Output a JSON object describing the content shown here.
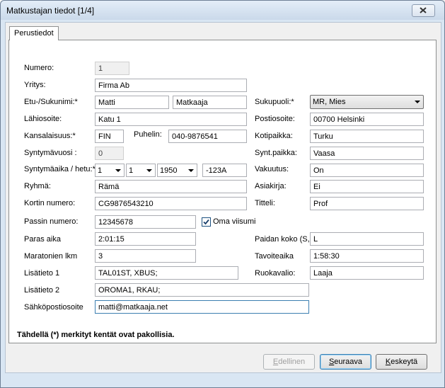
{
  "window": {
    "title": "Matkustajan tiedot [1/4]"
  },
  "tabs": {
    "basic": "Perustiedot"
  },
  "left": {
    "numero": {
      "label": "Numero:",
      "value": "1"
    },
    "yritys": {
      "label": "Yritys:",
      "value": "Firma Ab"
    },
    "nimi": {
      "label": "Etu-/Sukunimi:*",
      "first": "Matti",
      "last": "Matkaaja"
    },
    "lahiosoite": {
      "label": "Lähiosoite:",
      "value": "Katu 1"
    },
    "kansalaisuus": {
      "label": "Kansalaisuus:*",
      "value": "FIN"
    },
    "puhelin": {
      "label": "Puhelin:",
      "value": "040-9876541"
    },
    "syntymavuosi": {
      "label": "Syntymävuosi :",
      "value": "0"
    },
    "syntymaaika": {
      "label": "Syntymäaika / hetu:*",
      "day": "1",
      "month": "1",
      "year": "1950",
      "hetu": "-123A"
    },
    "ryhma": {
      "label": "Ryhmä:",
      "value": "Rämä"
    },
    "kortin_numero": {
      "label": "Kortin numero:",
      "value": "CG9876543210"
    },
    "passin_numero": {
      "label": "Passin numero:",
      "value": "12345678"
    },
    "oma_viisumi": {
      "label": "Oma viisumi",
      "checked": true
    },
    "paras_aika": {
      "label": "Paras aika",
      "value": "2:01:15"
    },
    "maratonien_lkm": {
      "label": "Maratonien lkm",
      "value": "3"
    },
    "lisatieto1": {
      "label": "Lisätieto 1",
      "value": "TAL01ST, XBUS;"
    },
    "lisatieto2": {
      "label": "Lisätieto 2",
      "value": "OROMA1, RKAU;"
    },
    "sahkoposti": {
      "label": "Sähköpostiosoite",
      "value": "matti@matkaaja.net"
    }
  },
  "right": {
    "sukupuoli": {
      "label": "Sukupuoli:*",
      "value": "MR, Mies"
    },
    "postiosoite": {
      "label": "Postiosoite:",
      "value": "00700 Helsinki"
    },
    "kotipaikka": {
      "label": "Kotipaikka:",
      "value": "Turku"
    },
    "syntpaikka": {
      "label": "Synt.paikka:",
      "value": "Vaasa"
    },
    "vakuutus": {
      "label": "Vakuutus:",
      "value": "On"
    },
    "asiakirja": {
      "label": "Asiakirja:",
      "value": "Ei"
    },
    "titteli": {
      "label": "Titteli:",
      "value": "Prof"
    },
    "paidan_koko": {
      "label": "Paidan koko (S,M",
      "value": "L"
    },
    "tavoiteaika": {
      "label": "Tavoiteaika",
      "value": "1:58:30"
    },
    "ruokavalio": {
      "label": "Ruokavalio:",
      "value": "Laaja"
    }
  },
  "note": "Tähdellä (*) merkityt kentät ovat pakollisia.",
  "buttons": {
    "prev": {
      "first": "E",
      "rest": "dellinen"
    },
    "next": {
      "first": "S",
      "rest": "euraava"
    },
    "cancel": {
      "first": "K",
      "rest": "eskeytä"
    }
  }
}
